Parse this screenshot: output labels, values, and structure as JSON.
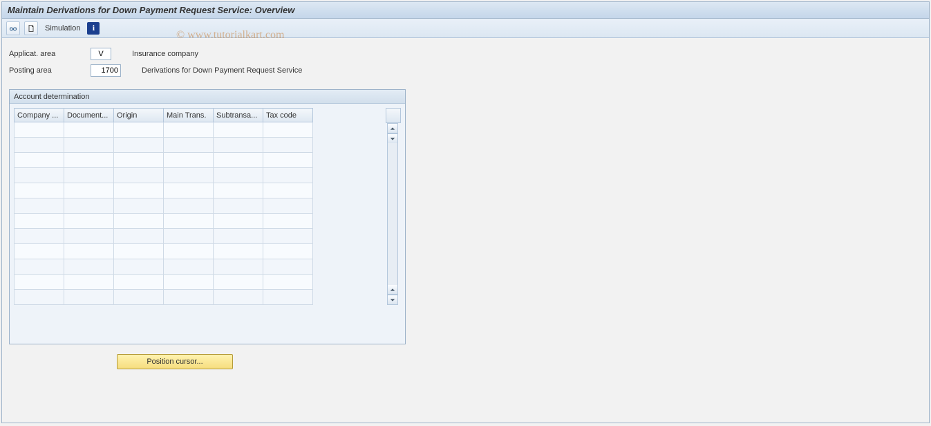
{
  "header": {
    "title": "Maintain Derivations for Down Payment Request Service: Overview"
  },
  "toolbar": {
    "simulation_label": "Simulation"
  },
  "watermark": "© www.tutorialkart.com",
  "fields": {
    "applicat": {
      "label": "Applicat. area",
      "value": "V",
      "desc": "Insurance company"
    },
    "posting": {
      "label": "Posting area",
      "value": "1700",
      "desc": "Derivations for Down Payment Request Service"
    }
  },
  "panel": {
    "title": "Account determination",
    "columns": {
      "company": "Company ...",
      "document": "Document...",
      "origin": "Origin",
      "main": "Main Trans.",
      "sub": "Subtransa...",
      "tax": "Tax code"
    },
    "row_count": 12
  },
  "buttons": {
    "position": "Position cursor..."
  }
}
